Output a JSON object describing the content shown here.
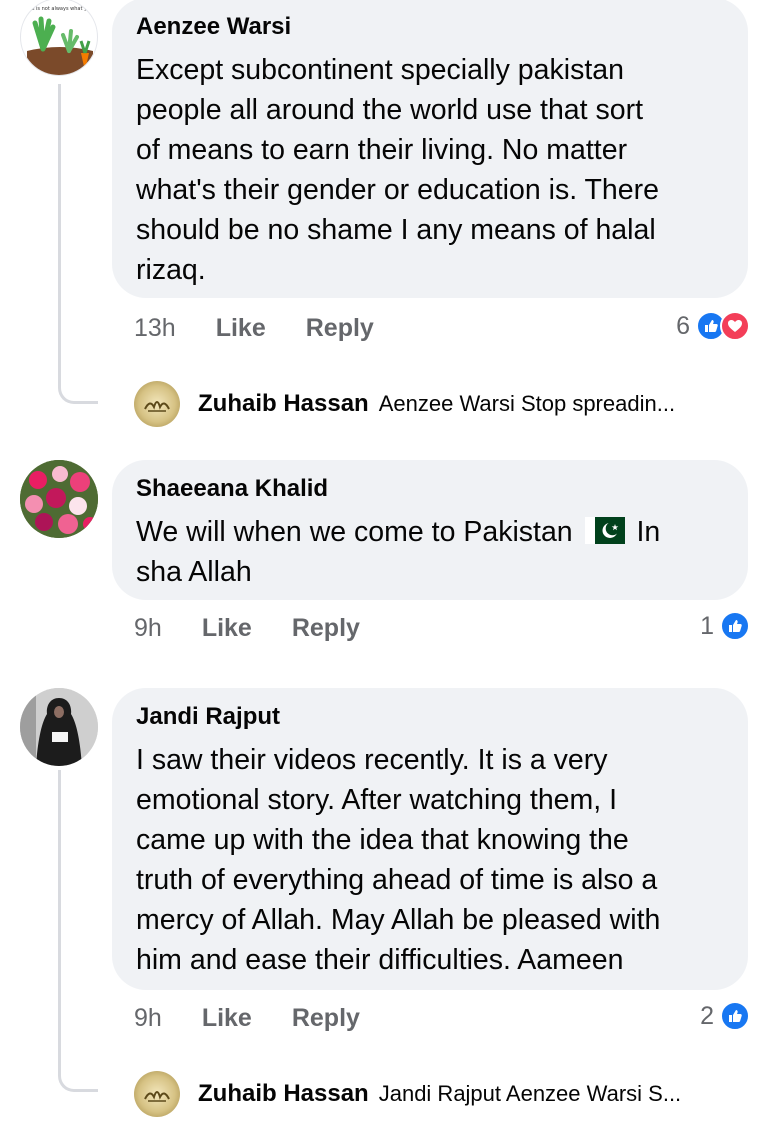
{
  "comments": [
    {
      "author": "Aenzee Warsi",
      "avatar_caption": "success is not always what you see.",
      "text_lines": [
        "Except subcontinent specially pakistan",
        "people all around the world use that sort",
        "of means to earn their living. No matter",
        "what's their gender or education is. There",
        "should be no shame I any means of halal",
        "rizaq."
      ],
      "time": "13h",
      "like_label": "Like",
      "reply_label": "Reply",
      "reaction_count": "6",
      "reactions": [
        "like-icon",
        "love-icon"
      ],
      "reply_preview": {
        "author": "Zuhaib Hassan",
        "text": "Aenzee Warsi Stop spreadin..."
      }
    },
    {
      "author": "Shaeeana Khalid",
      "text_line1_before_flag": "We will when we come to Pakistan",
      "flag_icon": "pakistan-flag-icon",
      "text_line1_after_flag": "In",
      "text_line2": "sha Allah",
      "time": "9h",
      "like_label": "Like",
      "reply_label": "Reply",
      "reaction_count": "1",
      "reactions": [
        "like-icon"
      ]
    },
    {
      "author": "Jandi Rajput",
      "text_lines": [
        "I saw their videos recently. It is a very",
        "emotional story. After watching them, I",
        "came up with the idea that knowing the",
        "truth of everything ahead of time is also a",
        "mercy of Allah. May Allah be pleased with",
        "him and ease their difficulties. Aameen"
      ],
      "time": "9h",
      "like_label": "Like",
      "reply_label": "Reply",
      "reaction_count": "2",
      "reactions": [
        "like-icon"
      ],
      "reply_preview": {
        "author": "Zuhaib Hassan",
        "text": "Jandi Rajput Aenzee Warsi S..."
      }
    }
  ],
  "colors": {
    "bubble": "#f0f2f5",
    "secondary_text": "#65676b",
    "like_blue": "#1877f2",
    "love_red": "#f33e58",
    "thread_line": "#d8dadf"
  }
}
